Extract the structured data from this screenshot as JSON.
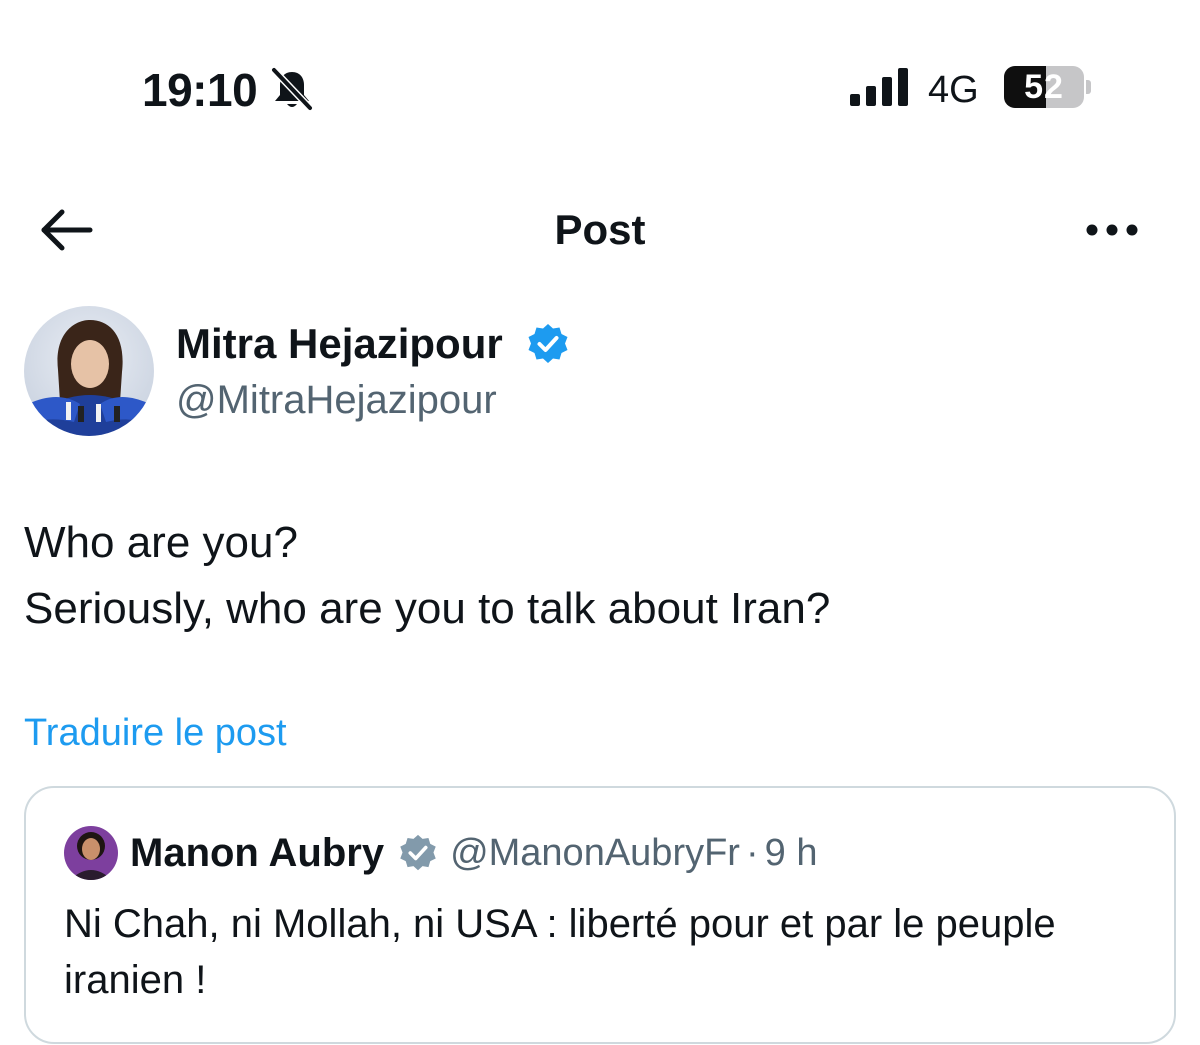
{
  "status_bar": {
    "time": "19:10",
    "network": "4G",
    "battery_level": "52",
    "battery_fraction": 0.52,
    "icons": [
      "bell-slash-icon",
      "signal-bars-icon",
      "battery-icon"
    ]
  },
  "nav": {
    "title": "Post",
    "back_icon": "arrow-left-icon",
    "more_icon": "more-dots-icon"
  },
  "author": {
    "name": "Mitra Hejazipour",
    "handle": "@MitraHejazipour",
    "verified": true,
    "verified_color": "#1d9bf0"
  },
  "post": {
    "lines": [
      "Who are you?",
      "Seriously, who are you to talk about Iran?"
    ],
    "translate_label": "Traduire le post",
    "link_color": "#1d9bf0"
  },
  "quote": {
    "name": "Manon Aubry",
    "handle": "@ManonAubryFr",
    "separator": "·",
    "time": "9 h",
    "text": "Ni Chah, ni Mollah, ni USA : liberté pour et par le peuple iranien !",
    "verified_color": "#829aab"
  },
  "colors": {
    "text_primary": "#0f1419",
    "text_secondary": "#536471",
    "border": "#cfd9de"
  }
}
